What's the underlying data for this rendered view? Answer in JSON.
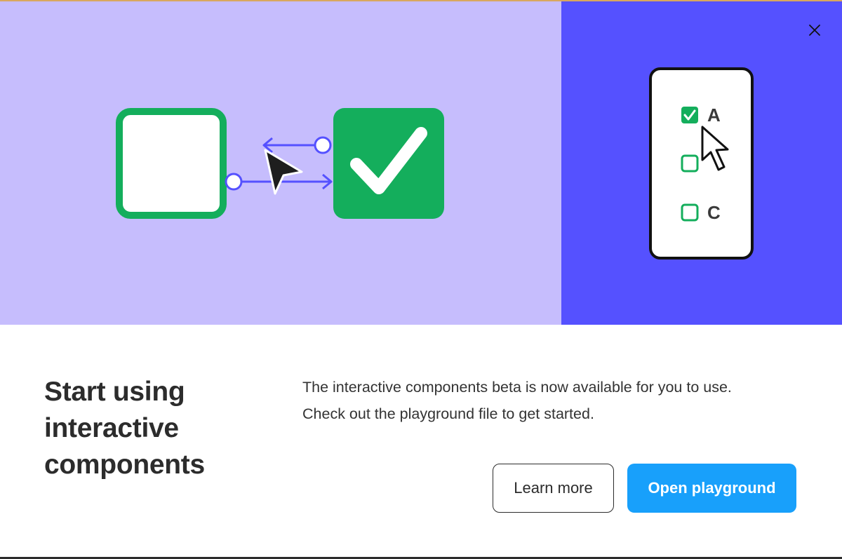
{
  "dialog": {
    "title": "Start using interactive components",
    "description_line1": "The interactive components beta is now available for you to use.",
    "description_line2": "Check out the playground file to get started.",
    "learn_more_label": "Learn more",
    "open_playground_label": "Open playground"
  },
  "illustration": {
    "options": [
      "A",
      "",
      "C"
    ],
    "checked_option": "A"
  },
  "colors": {
    "hero_left_bg": "#c6bdfd",
    "hero_right_bg": "#5551ff",
    "check_green": "#14ae5c",
    "primary_button": "#18a0fb",
    "title_text": "#2c2c2c"
  },
  "icons": {
    "close": "close-icon",
    "checkbox": "checkbox-icon",
    "cursor": "cursor-icon",
    "checkmark": "checkmark-icon"
  }
}
